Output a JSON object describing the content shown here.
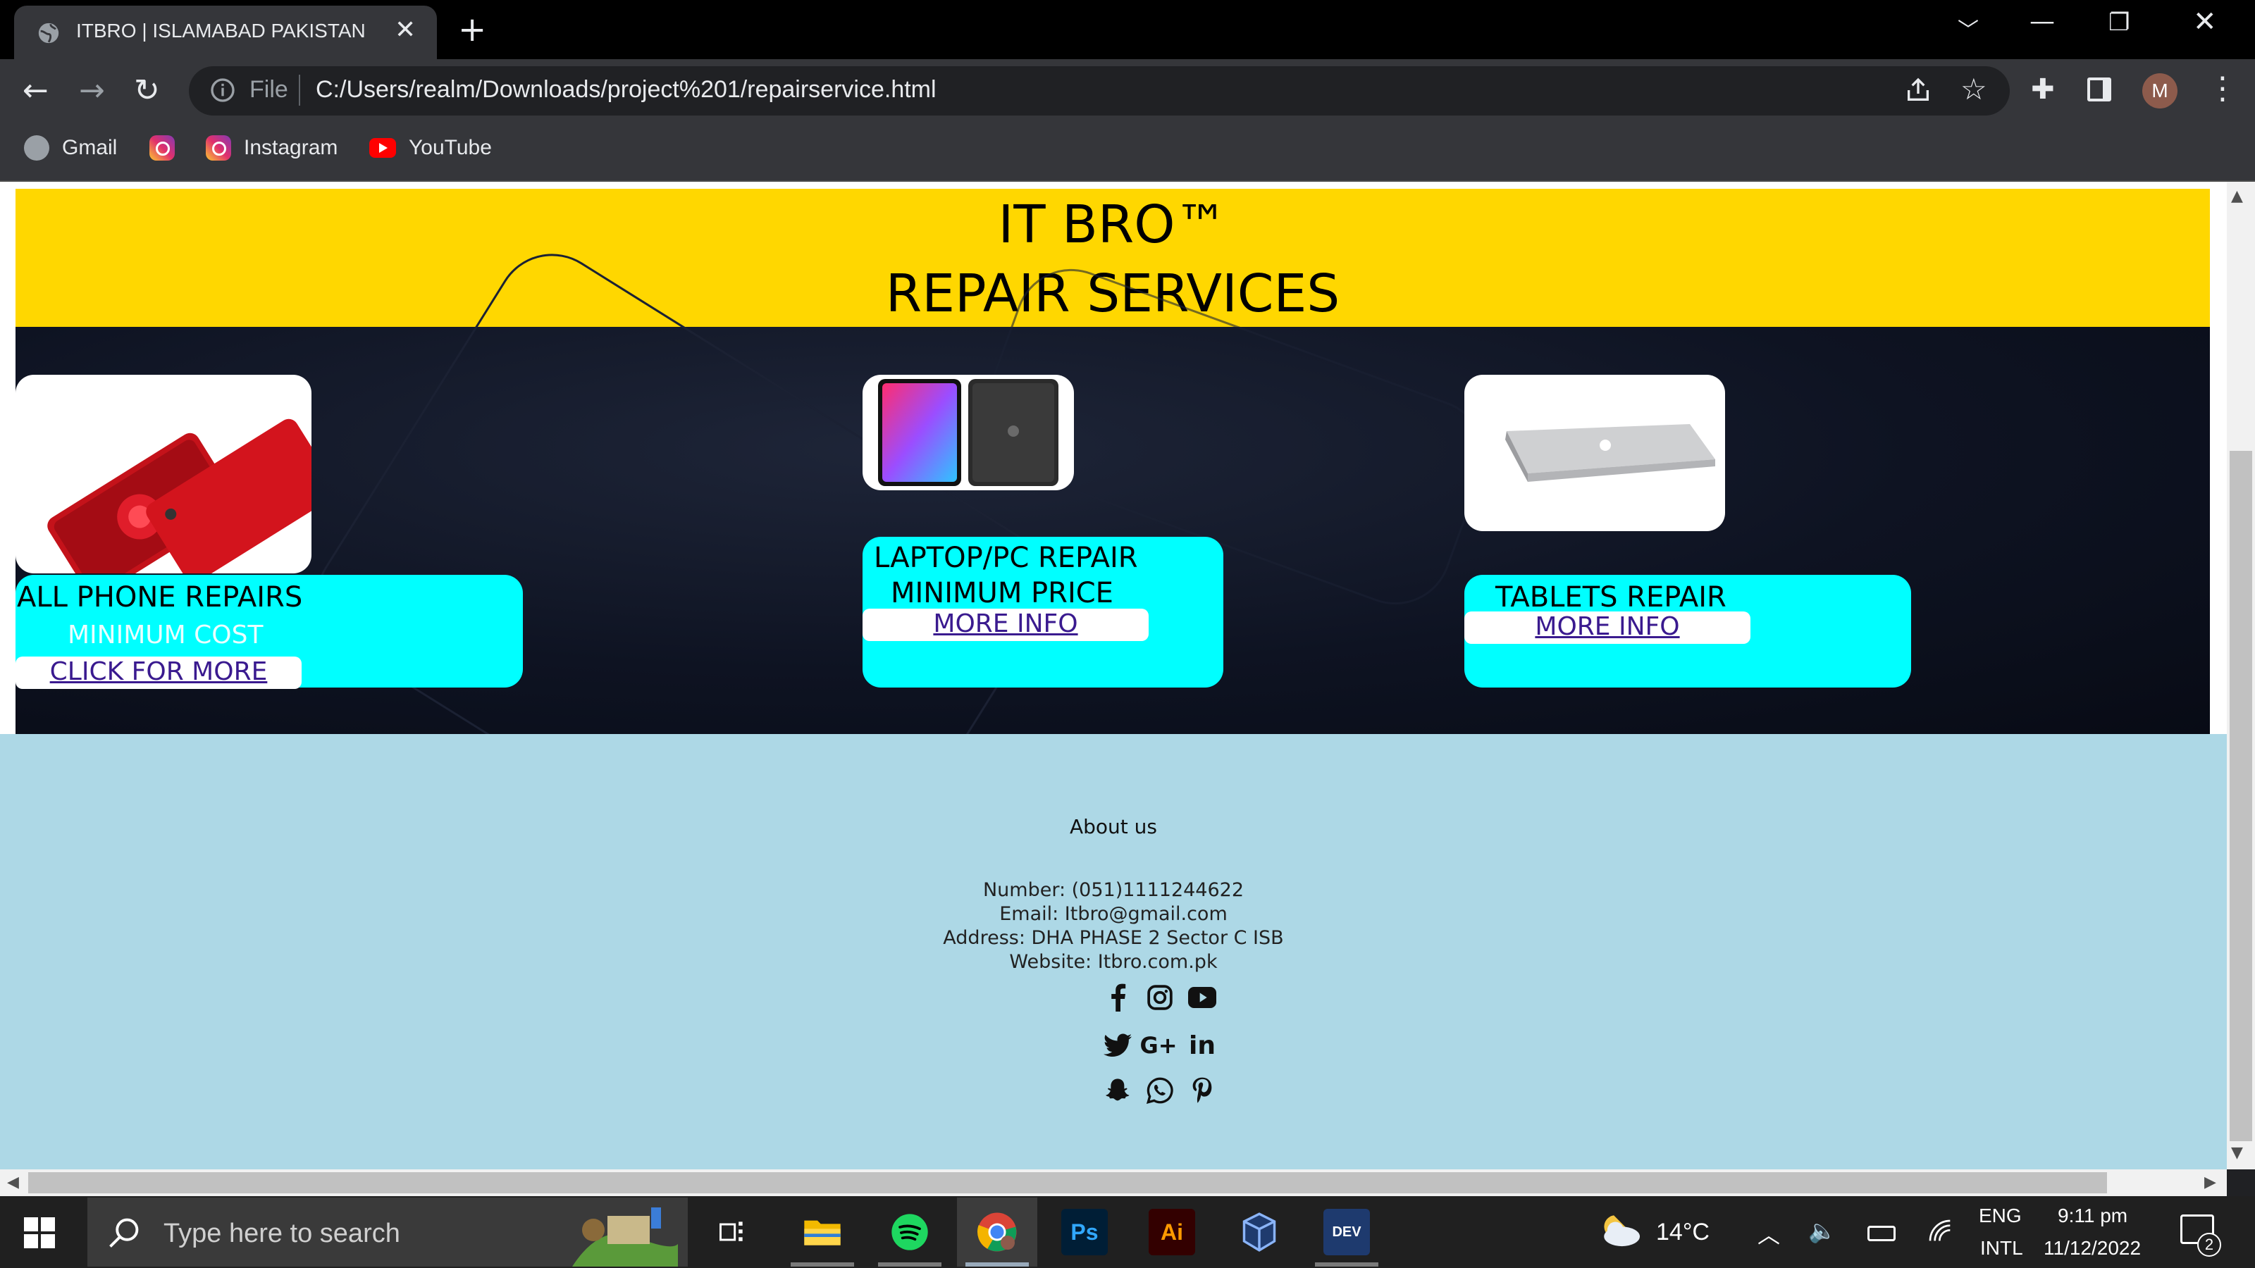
{
  "browser": {
    "tab_title": "ITBRO | ISLAMABAD PAKISTAN",
    "file_label": "File",
    "url": "C:/Users/realm/Downloads/project%201/repairservice.html",
    "profile_initial": "M",
    "bookmarks": [
      {
        "label": "Gmail",
        "icon": "globe-icon"
      },
      {
        "label": "",
        "icon": "instagram-icon"
      },
      {
        "label": "Instagram",
        "icon": "instagram-icon"
      },
      {
        "label": "YouTube",
        "icon": "youtube-icon"
      }
    ]
  },
  "page": {
    "header": {
      "line1": "IT BRO™",
      "line2": "REPAIR SERVICES",
      "bg_color": "#ffd700"
    },
    "cards": [
      {
        "title": "ALL PHONE REPAIRS",
        "subtitle": "MINIMUM COST",
        "link": "CLICK FOR MORE"
      },
      {
        "title": "LAPTOP/PC REPAIR",
        "subtitle": "MINIMUM PRICE",
        "link": "MORE INFO"
      },
      {
        "title": "TABLETS REPAIR",
        "subtitle": "",
        "link": "MORE INFO"
      }
    ],
    "card_color": "#00ffff",
    "footer": {
      "heading": "About us",
      "number": "Number: (051)1111244622",
      "email": "Email: Itbro@gmail.com",
      "address": "Address: DHA PHASE 2 Sector C ISB",
      "website": "Website: Itbro.com.pk",
      "bg_color": "#add8e6",
      "social_icons": [
        "facebook-icon",
        "instagram-icon",
        "youtube-icon",
        "twitter-icon",
        "google-plus-icon",
        "linkedin-icon",
        "snapchat-icon",
        "whatsapp-icon",
        "pinterest-icon"
      ],
      "google_plus_text": "G+",
      "linkedin_text": "in"
    }
  },
  "taskbar": {
    "search_placeholder": "Type here to search",
    "apps": [
      "task-view-icon",
      "file-explorer-icon",
      "spotify-icon",
      "chrome-icon",
      "photoshop-icon",
      "illustrator-icon",
      "virtualbox-icon",
      "devcpp-icon"
    ],
    "ps_label": "Ps",
    "ai_label": "Ai",
    "dev_label": "DEV",
    "weather_temp": "14°C",
    "lang_line1": "ENG",
    "lang_line2": "INTL",
    "time": "9:11 pm",
    "date": "11/12/2022",
    "notification_count": "2"
  }
}
